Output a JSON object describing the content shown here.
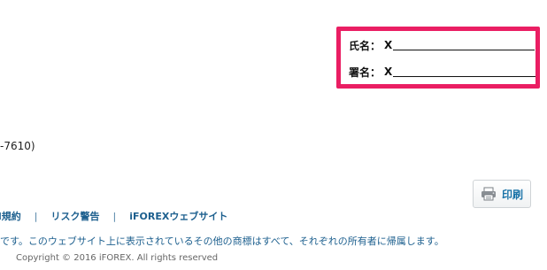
{
  "signature": {
    "name_label": "氏名：",
    "name_x": "X",
    "sign_label": "署名：",
    "sign_x": "X"
  },
  "contact": {
    "phone_fragment": "-7610)"
  },
  "print_button": {
    "label": "印刷",
    "icon": "printer-icon"
  },
  "footer": {
    "links": [
      {
        "label": "l規約"
      },
      {
        "label": "リスク警告"
      },
      {
        "label": "iFOREXウェブサイト"
      }
    ],
    "separator": "|",
    "trademark_notice": "です。このウェブサイト上に表示されているその他の商標はすべて、それぞれの所有者に帰属します。",
    "copyright": "Copyright © 2016 iFOREX. All rights reserved"
  },
  "colors": {
    "highlight_border": "#ea1e63",
    "link": "#1c5f8e",
    "print_label": "#1a73a8"
  }
}
